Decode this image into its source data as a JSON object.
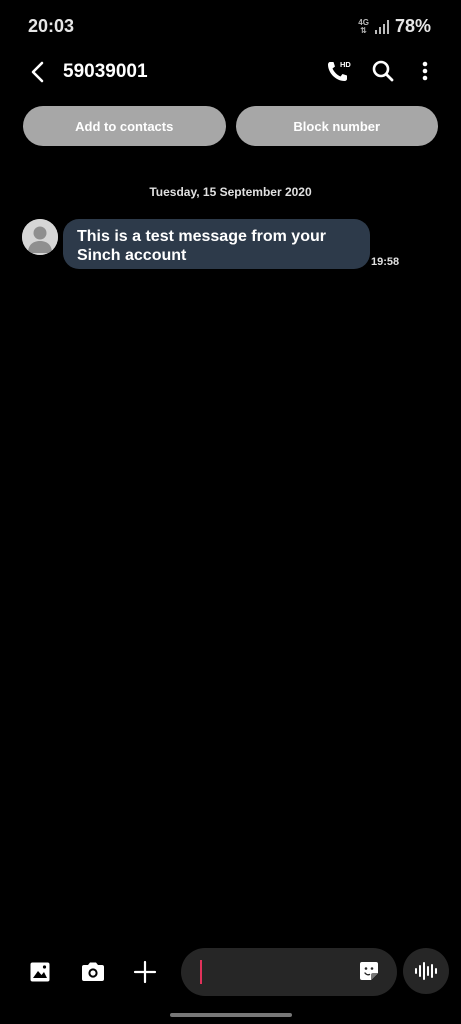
{
  "status_bar": {
    "time": "20:03",
    "network_type": "4G",
    "battery": "78%"
  },
  "app_bar": {
    "title": "59039001"
  },
  "actions": {
    "add_contact_label": "Add to contacts",
    "block_label": "Block number"
  },
  "conversation": {
    "date": "Tuesday, 15 September 2020",
    "messages": [
      {
        "text": "This is a test message from your Sinch account",
        "time": "19:58"
      }
    ]
  },
  "composer": {
    "value": ""
  },
  "colors": {
    "bubble": "#2d3a4a",
    "pill": "#a7a7a7",
    "cursor": "#e0325a",
    "input_bg": "#262626"
  }
}
